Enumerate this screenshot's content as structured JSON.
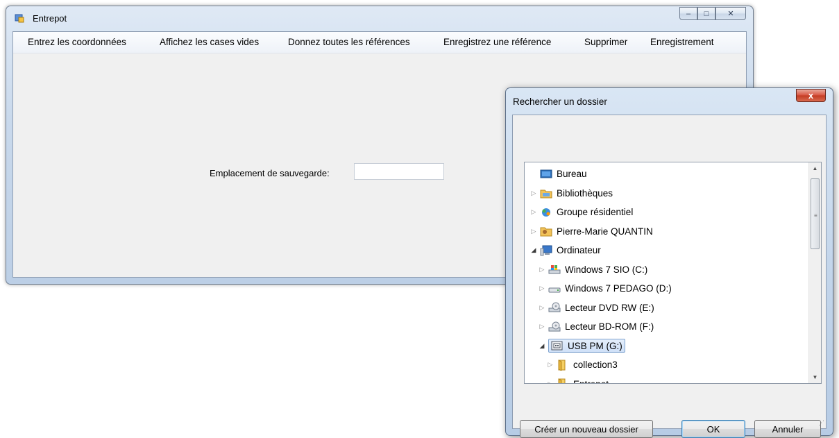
{
  "main_window": {
    "title": "Entrepot",
    "menu": [
      "Entrez les coordonnées",
      "Affichez les cases vides",
      "Donnez toutes les références",
      "Enregistrez une référence",
      "Supprimer",
      "Enregistrement"
    ],
    "save_location_label": "Emplacement de sauvegarde:",
    "save_location_value": ""
  },
  "dialog": {
    "title": "Rechercher un dossier",
    "close_label": "x",
    "tree": [
      {
        "label": "Bureau",
        "icon": "desktop-icon",
        "indent": 0,
        "expander": "none"
      },
      {
        "label": "Bibliothèques",
        "icon": "libraries-icon",
        "indent": 0,
        "expander": "collapsed"
      },
      {
        "label": "Groupe résidentiel",
        "icon": "homegroup-icon",
        "indent": 0,
        "expander": "collapsed"
      },
      {
        "label": "Pierre-Marie QUANTIN",
        "icon": "user-folder-icon",
        "indent": 0,
        "expander": "collapsed"
      },
      {
        "label": "Ordinateur",
        "icon": "computer-icon",
        "indent": 0,
        "expander": "expanded"
      },
      {
        "label": "Windows 7 SIO (C:)",
        "icon": "system-drive-icon",
        "indent": 1,
        "expander": "collapsed"
      },
      {
        "label": "Windows 7 PEDAGO (D:)",
        "icon": "hard-drive-icon",
        "indent": 1,
        "expander": "collapsed"
      },
      {
        "label": "Lecteur DVD RW (E:)",
        "icon": "dvd-drive-icon",
        "indent": 1,
        "expander": "collapsed"
      },
      {
        "label": "Lecteur BD-ROM (F:)",
        "icon": "bd-drive-icon",
        "indent": 1,
        "expander": "collapsed"
      },
      {
        "label": "USB PM (G:)",
        "icon": "usb-drive-icon",
        "indent": 1,
        "expander": "expanded",
        "selected": true
      },
      {
        "label": "collection3",
        "icon": "folder-icon",
        "indent": 2,
        "expander": "collapsed"
      },
      {
        "label": "Entrepot",
        "icon": "folder-icon",
        "indent": 2,
        "expander": "collapsed"
      }
    ],
    "buttons": {
      "new_folder": "Créer un nouveau dossier",
      "ok": "OK",
      "cancel": "Annuler"
    }
  },
  "window_controls": {
    "minimize": "–",
    "maximize": "□",
    "close": "✕"
  }
}
